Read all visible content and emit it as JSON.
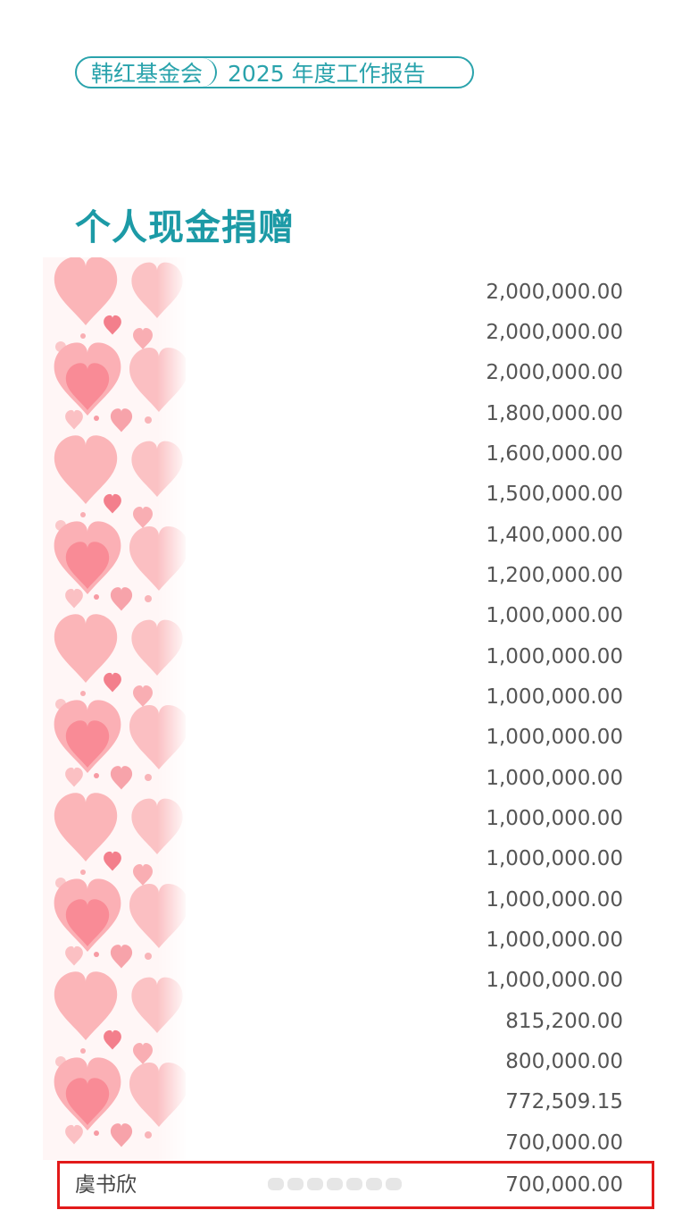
{
  "header": {
    "organization": "韩红基金会",
    "report_title": "2025 年度工作报告"
  },
  "section": {
    "title": "个人现金捐赠"
  },
  "donations": [
    {
      "amount": "2,000,000.00"
    },
    {
      "amount": "2,000,000.00"
    },
    {
      "amount": "2,000,000.00"
    },
    {
      "amount": "1,800,000.00"
    },
    {
      "amount": "1,600,000.00"
    },
    {
      "amount": "1,500,000.00"
    },
    {
      "amount": "1,400,000.00"
    },
    {
      "amount": "1,200,000.00"
    },
    {
      "amount": "1,000,000.00"
    },
    {
      "amount": "1,000,000.00"
    },
    {
      "amount": "1,000,000.00"
    },
    {
      "amount": "1,000,000.00"
    },
    {
      "amount": "1,000,000.00"
    },
    {
      "amount": "1,000,000.00"
    },
    {
      "amount": "1,000,000.00"
    },
    {
      "amount": "1,000,000.00"
    },
    {
      "amount": "1,000,000.00"
    },
    {
      "amount": "1,000,000.00"
    },
    {
      "amount": "815,200.00"
    },
    {
      "amount": "800,000.00"
    },
    {
      "amount": "772,509.15"
    },
    {
      "amount": "700,000.00"
    }
  ],
  "highlighted": {
    "name": "虞书欣",
    "amount": "700,000.00"
  },
  "colors": {
    "accent": "#2aa3ac",
    "highlight_border": "#e21a1a",
    "heart_pink": "#f79aa3"
  }
}
